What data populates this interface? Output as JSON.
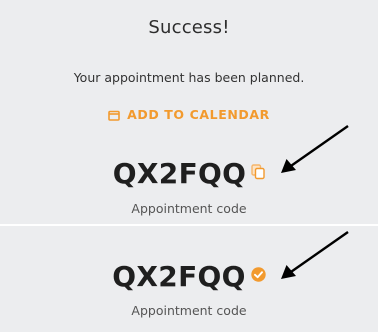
{
  "success": {
    "title": "Success!",
    "message": "Your appointment has been planned.",
    "add_to_calendar_label": "ADD TO CALENDAR"
  },
  "appointment_before_copy": {
    "code": "QX2FQQ",
    "label": "Appointment code",
    "icon": "copy-icon"
  },
  "appointment_after_copy": {
    "code": "QX2FQQ",
    "label": "Appointment code",
    "icon": "check-circle-icon"
  },
  "colors": {
    "panel_background": "#ecedef",
    "accent": "#f29a2e",
    "code_text": "#1f1f1f",
    "arrow": "#000000"
  }
}
